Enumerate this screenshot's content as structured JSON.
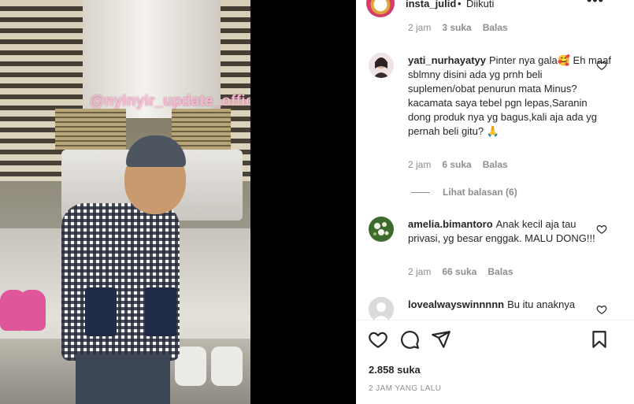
{
  "media": {
    "watermark": "@nyinyir_update_official"
  },
  "header": {
    "username": "insta_julid",
    "separator": "•",
    "follow_status": "Diikuti",
    "more_icon": "more-icon",
    "more_label": "•••"
  },
  "comments": [
    {
      "username": "",
      "text": "",
      "time": "2 jam",
      "likes": "3 suka",
      "reply": "Balas",
      "partial": "top"
    },
    {
      "username": "yati_nurhayatyy",
      "text": "Pinter nya gala🥰 Eh maaf sblmny disini ada yg prnh beli suplemen/obat penurun mata Minus? kacamata saya tebel pgn lepas,Saranin dong produk nya yg bagus,kali aja ada yg pernah beli gitu? 🙏",
      "time": "2 jam",
      "likes": "6 suka",
      "reply": "Balas",
      "view_replies": "Lihat balasan (6)"
    },
    {
      "username": "amelia.bimantoro",
      "text": "Anak kecil aja tau privasi, yg besar enggak. MALU DONG!!!",
      "time": "2 jam",
      "likes": "66 suka",
      "reply": "Balas"
    },
    {
      "username": "lovealwayswinnnnn",
      "text": "Bu itu anaknya",
      "partial": "bottom"
    }
  ],
  "actions": {
    "like_icon": "heart-icon",
    "comment_icon": "comment-icon",
    "share_icon": "share-icon",
    "save_icon": "bookmark-icon"
  },
  "post": {
    "likes": "2.858 suka",
    "posted": "2 JAM YANG LALU"
  },
  "colors": {
    "text": "#262626",
    "muted": "#8e8e8e",
    "divider": "#efefef",
    "media_bg": "#000000"
  }
}
